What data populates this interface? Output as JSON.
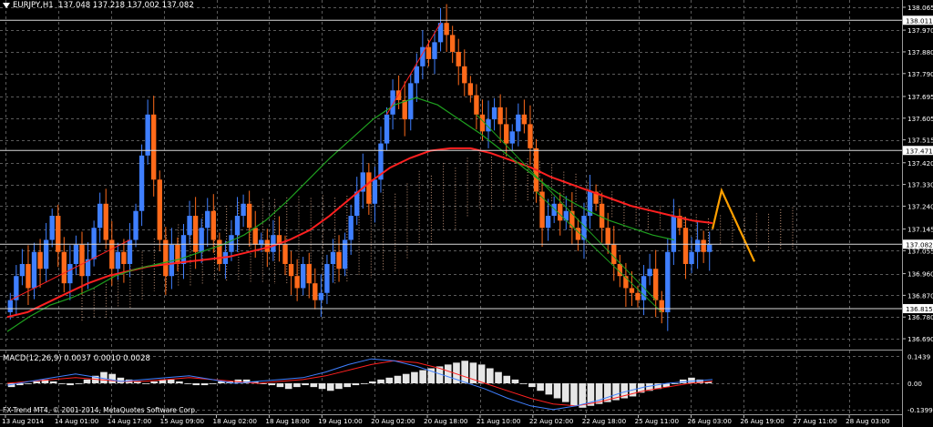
{
  "header": {
    "symbol": "EURJPY,H1",
    "ohlc": "137.048 137.218 137.002 137.082"
  },
  "macd_header": "MACD(12,26,9) 0.0037 0.0010 0.0028",
  "copyright": "FX-Trend MT4, © 2001-2014, MetaQuotes Software Corp.",
  "colors": {
    "background": "#000000",
    "grid": "#5a5a5a",
    "bull": "#3f7fff",
    "bear": "#ff6a1a",
    "ma_red": "#ff2020",
    "ma_green": "#1fa01f",
    "cloud": "#e8b090",
    "projection": "#ffa000"
  },
  "chart_data": [
    {
      "type": "line",
      "title": "EURJPY,H1",
      "price_ticks": [
        "138.065",
        "137.970",
        "137.880",
        "137.790",
        "137.695",
        "137.605",
        "137.515",
        "137.420",
        "137.330",
        "137.240",
        "137.145",
        "137.055",
        "136.960",
        "136.870",
        "136.780",
        "136.690"
      ],
      "price_markers": [
        {
          "label": "138.011",
          "value": 138.011
        },
        {
          "label": "137.471",
          "value": 137.471
        },
        {
          "label": "137.082",
          "value": 137.082
        },
        {
          "label": "136.815",
          "value": 136.815
        }
      ],
      "time_ticks": [
        "13 Aug 2014",
        "14 Aug 01:00",
        "14 Aug 17:00",
        "15 Aug 09:00",
        "18 Aug 02:00",
        "18 Aug 18:00",
        "19 Aug 10:00",
        "20 Aug 02:00",
        "20 Aug 18:00",
        "21 Aug 10:00",
        "22 Aug 02:00",
        "22 Aug 18:00",
        "25 Aug 11:00",
        "26 Aug 03:00",
        "26 Aug 19:00",
        "27 Aug 11:00",
        "28 Aug 03:00"
      ],
      "ylim": [
        136.66,
        138.08
      ],
      "grid": true,
      "series": [
        {
          "role": "price",
          "values": [
            136.85,
            136.95,
            137.0,
            136.9,
            137.05,
            136.98,
            137.1,
            137.2,
            137.05,
            136.92,
            137.0,
            137.08,
            136.95,
            137.02,
            137.15,
            137.25,
            137.1,
            136.98,
            137.05,
            137.0,
            137.1,
            137.22,
            137.45,
            137.62,
            137.35,
            137.1,
            136.95,
            137.08,
            137.0,
            137.12,
            137.2,
            137.05,
            137.15,
            137.22,
            137.1,
            137.0,
            137.05,
            137.12,
            137.2,
            137.25,
            137.15,
            137.08,
            137.1,
            137.05,
            137.12,
            137.08,
            137.0,
            136.95,
            136.9,
            137.0,
            136.92,
            136.85,
            136.88,
            137.0,
            137.05,
            136.98,
            137.1,
            137.2,
            137.3,
            137.38,
            137.25,
            137.35,
            137.5,
            137.62,
            137.72,
            137.68,
            137.6,
            137.75,
            137.82,
            137.9,
            137.85,
            137.92,
            138.0,
            137.95,
            137.88,
            137.82,
            137.75,
            137.7,
            137.62,
            137.55,
            137.6,
            137.65,
            137.58,
            137.5,
            137.55,
            137.62,
            137.58,
            137.48,
            137.3,
            137.15,
            137.2,
            137.25,
            137.18,
            137.22,
            137.15,
            137.1,
            137.2,
            137.3,
            137.25,
            137.15,
            137.08,
            137.0,
            136.95,
            136.9,
            136.88,
            136.85,
            136.95,
            136.98,
            136.85,
            136.8,
            137.05,
            137.2,
            137.15,
            137.0,
            137.05,
            137.1,
            137.05,
            137.08
          ]
        },
        {
          "role": "moving-average-red",
          "values": [
            136.78,
            136.8,
            136.84,
            136.88,
            136.92,
            136.95,
            136.97,
            136.99,
            137.0,
            137.01,
            137.02,
            137.03,
            137.05,
            137.07,
            137.1,
            137.14,
            137.2,
            137.27,
            137.34,
            137.4,
            137.44,
            137.47,
            137.48,
            137.48,
            137.46,
            137.43,
            137.4,
            137.36,
            137.33,
            137.3,
            137.27,
            137.24,
            137.22,
            137.2,
            137.18,
            137.17
          ]
        },
        {
          "role": "moving-average-green",
          "values": [
            136.72,
            136.78,
            136.83,
            136.86,
            136.9,
            136.95,
            136.98,
            137.0,
            137.02,
            137.05,
            137.08,
            137.12,
            137.18,
            137.26,
            137.35,
            137.44,
            137.52,
            137.6,
            137.66,
            137.69,
            137.66,
            137.6,
            137.54,
            137.47,
            137.4,
            137.33,
            137.27,
            137.22,
            137.18,
            137.15,
            137.12,
            137.1
          ]
        }
      ],
      "projection": [
        137.145,
        137.305,
        137.01
      ]
    },
    {
      "type": "bar",
      "title": "MACD(12,26,9)",
      "ticks": [
        "0.1439",
        "0.00",
        "-0.1399"
      ],
      "ylim": [
        -0.16,
        0.16
      ],
      "series": [
        {
          "role": "histogram",
          "values": [
            -0.02,
            -0.01,
            0.0,
            0.01,
            0.02,
            0.01,
            0.0,
            -0.01,
            0.0,
            0.02,
            0.04,
            0.06,
            0.05,
            0.03,
            0.02,
            0.01,
            0.0,
            0.01,
            0.02,
            0.02,
            0.01,
            0.0,
            -0.01,
            -0.01,
            0.0,
            0.01,
            0.01,
            0.02,
            0.02,
            0.01,
            0.0,
            -0.01,
            -0.02,
            -0.03,
            -0.02,
            -0.01,
            -0.02,
            -0.03,
            -0.04,
            -0.03,
            -0.02,
            -0.01,
            0.0,
            0.01,
            0.02,
            0.03,
            0.04,
            0.05,
            0.06,
            0.07,
            0.08,
            0.09,
            0.1,
            0.11,
            0.12,
            0.11,
            0.1,
            0.08,
            0.06,
            0.04,
            0.02,
            0.0,
            -0.02,
            -0.04,
            -0.06,
            -0.08,
            -0.1,
            -0.12,
            -0.13,
            -0.12,
            -0.11,
            -0.1,
            -0.09,
            -0.08,
            -0.07,
            -0.05,
            -0.04,
            -0.03,
            -0.02,
            0.0,
            0.02,
            0.03,
            0.02,
            0.01
          ]
        },
        {
          "role": "signal",
          "values": [
            0.0,
            0.01,
            0.02,
            0.03,
            0.02,
            0.01,
            0.01,
            0.02,
            0.03,
            0.02,
            0.01,
            0.0,
            0.01,
            0.02,
            0.04,
            0.07,
            0.1,
            0.12,
            0.11,
            0.08,
            0.04,
            0.0,
            -0.04,
            -0.08,
            -0.11,
            -0.12,
            -0.1,
            -0.07,
            -0.04,
            -0.02,
            0.0,
            0.01
          ]
        },
        {
          "role": "macd",
          "values": [
            -0.01,
            0.01,
            0.03,
            0.05,
            0.03,
            0.01,
            0.02,
            0.03,
            0.04,
            0.02,
            0.0,
            0.01,
            0.02,
            0.03,
            0.06,
            0.1,
            0.13,
            0.12,
            0.09,
            0.05,
            0.01,
            -0.03,
            -0.08,
            -0.12,
            -0.14,
            -0.12,
            -0.09,
            -0.05,
            -0.02,
            0.0,
            0.01,
            0.02
          ]
        }
      ]
    }
  ]
}
